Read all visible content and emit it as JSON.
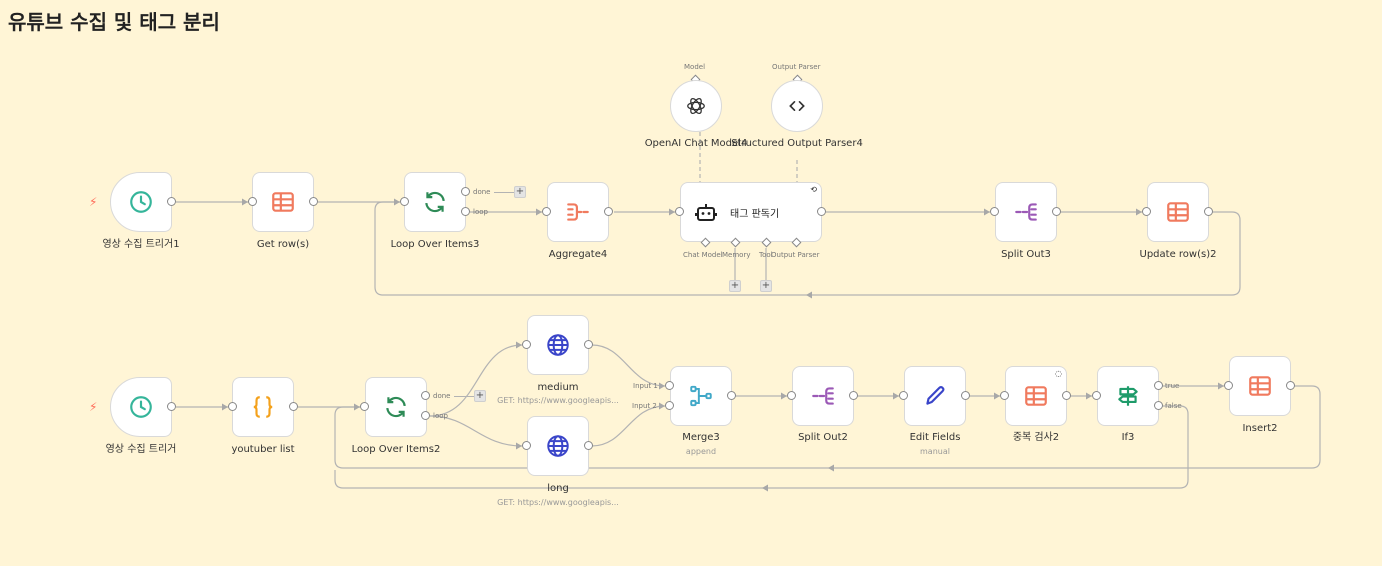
{
  "workflow_title": "유튜브 수집 및 태그 분리",
  "nodes": {
    "trigger1": {
      "label": "영상 수집 트리거1"
    },
    "get_rows": {
      "label": "Get row(s)"
    },
    "loop3": {
      "label": "Loop Over Items3",
      "done": "done",
      "loop": "loop"
    },
    "aggregate4": {
      "label": "Aggregate4"
    },
    "openai": {
      "label": "OpenAI Chat Model4",
      "port_label": "Model"
    },
    "parser": {
      "label": "Structured Output Parser4",
      "port_label": "Output Parser"
    },
    "tag_agent": {
      "label": "태그 판독기",
      "port_chat": "Chat Model",
      "port_memory": "Memory",
      "port_tool": "Tool",
      "port_parser": "Output Parser"
    },
    "split3": {
      "label": "Split Out3"
    },
    "update2": {
      "label": "Update row(s)2"
    },
    "trigger2": {
      "label": "영상 수집 트리거"
    },
    "youtuber": {
      "label": "youtuber list"
    },
    "loop2": {
      "label": "Loop Over Items2",
      "done": "done",
      "loop": "loop"
    },
    "medium": {
      "label": "medium",
      "sub": "GET: https://www.googleapis..."
    },
    "long": {
      "label": "long",
      "sub": "GET: https://www.googleapis..."
    },
    "merge3": {
      "label": "Merge3",
      "sub": "append",
      "input1": "Input 1",
      "input2": "Input 2"
    },
    "split2": {
      "label": "Split Out2"
    },
    "edit": {
      "label": "Edit Fields",
      "sub": "manual"
    },
    "dup": {
      "label": "중복 검사2"
    },
    "if3": {
      "label": "If3",
      "true": "true",
      "false": "false"
    },
    "insert2": {
      "label": "Insert2"
    }
  },
  "plus_symbol": "+",
  "colors": {
    "canvas": "#fff5d6",
    "trigger": "#35b59a",
    "table": "#f07a5e",
    "loop": "#2e8b57",
    "aggregate": "#f07a5e",
    "split": "#9b59b6",
    "http": "#3a45c9",
    "code": "#f4a11b",
    "merge": "#40a8c8",
    "edit": "#3a45c9",
    "if": "#1e9b6a"
  },
  "icons": {
    "trigger": "clock-icon",
    "table": "table-icon",
    "loop": "refresh-icon",
    "aggregate": "aggregate-icon",
    "agent": "robot-icon",
    "openai": "openai-icon",
    "parser": "code-icon",
    "split": "split-icon",
    "code": "braces-icon",
    "http": "globe-icon",
    "merge": "merge-icon",
    "edit": "pen-icon",
    "if": "signpost-icon"
  }
}
